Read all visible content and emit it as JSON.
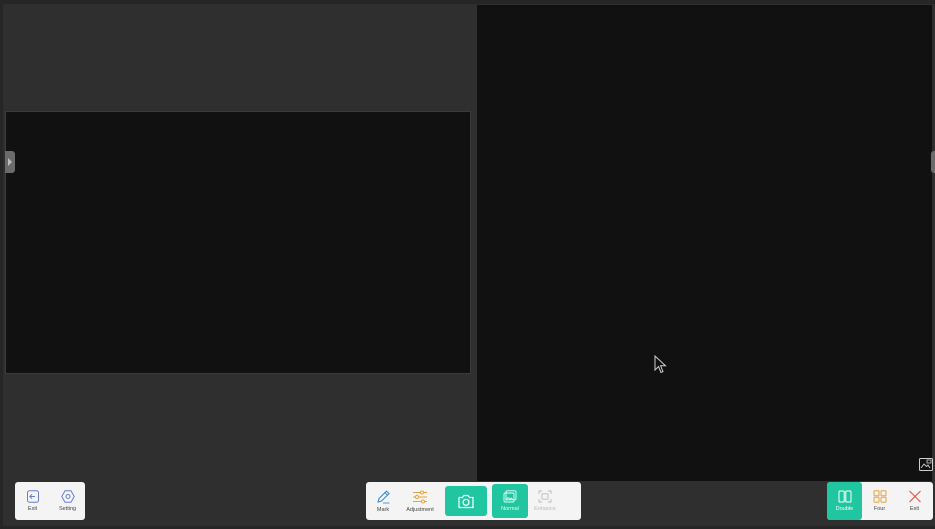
{
  "left_toolbar": {
    "exit_label": "Exit",
    "setting_label": "Setting"
  },
  "center_toolbar": {
    "mark_label": "Mark",
    "adjustment_label": "Adjustment",
    "normal_label": "Normal",
    "enhance_label": "Enhance"
  },
  "right_toolbar": {
    "double_label": "Double",
    "four_label": "Four",
    "exit_label": "Exit"
  },
  "colors": {
    "accent": "#1fc6a0",
    "adjust_orange": "#e8a33a",
    "close_red": "#e8574c",
    "pen_blue": "#3a8fd8"
  },
  "icons": {
    "exit": "exit-icon",
    "setting": "setting-icon",
    "mark": "pen-icon",
    "adjustment": "sliders-icon",
    "capture": "camera-icon",
    "normal": "normal-mode-icon",
    "enhance": "enhance-mode-icon",
    "double": "double-split-icon",
    "four": "four-grid-icon",
    "close": "close-icon",
    "pip": "picture-in-picture-icon"
  }
}
